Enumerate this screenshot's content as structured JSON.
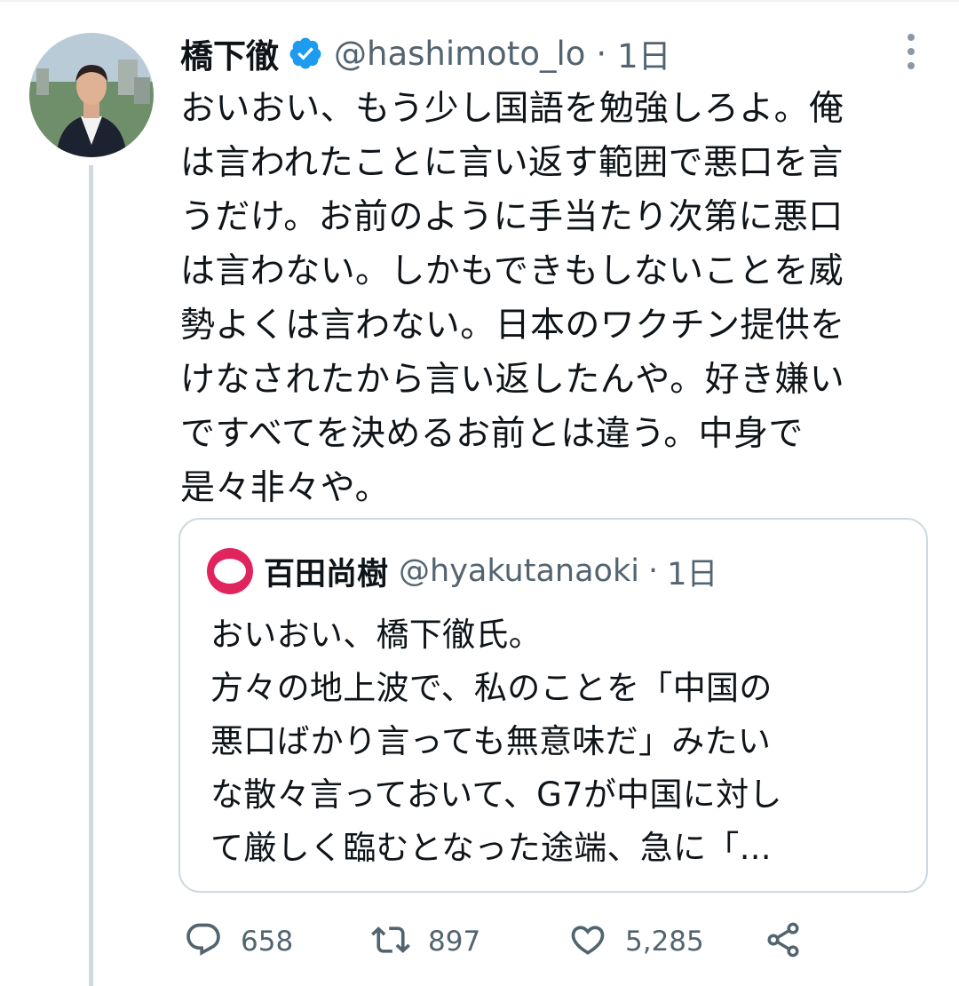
{
  "tweet": {
    "author_name": "橋下徹",
    "handle": "@hashimoto_lo",
    "separator": "·",
    "time": "1日",
    "lines": [
      "おいおい、もう少し国語を勉強しろよ。俺",
      "は言われたことに言い返す範囲で悪口を言",
      "うだけ。お前のように手当たり次第に悪口",
      "は言わない。しかもできもしないことを威",
      "勢よくは言わない。日本のワクチン提供を",
      "けなされたから言い返したんや。好き嫌い",
      "ですべてを決めるお前とは違う。中身で",
      "是々非々や。"
    ]
  },
  "quoted": {
    "author_name": "百田尚樹",
    "handle": "@hyakutanaoki",
    "separator": "·",
    "time": "1日",
    "lines": [
      "おいおい、橋下徹氏。",
      "方々の地上波で、私のことを「中国の",
      "悪口ばかり言っても無意味だ」みたい",
      "な散々言っておいて、G7が中国に対し",
      "て厳しく臨むとなった途端、急に「..."
    ]
  },
  "actions": {
    "reply_count": "658",
    "retweet_count": "897",
    "like_count": "5,285"
  },
  "colors": {
    "verified": "#1d9bf0",
    "quoted_avatar": "#e0245e",
    "secondary_text": "#536471",
    "border": "#cfd9de"
  },
  "icons": [
    "verified-badge-icon",
    "more-icon",
    "reply-icon",
    "retweet-icon",
    "like-icon",
    "share-icon"
  ]
}
